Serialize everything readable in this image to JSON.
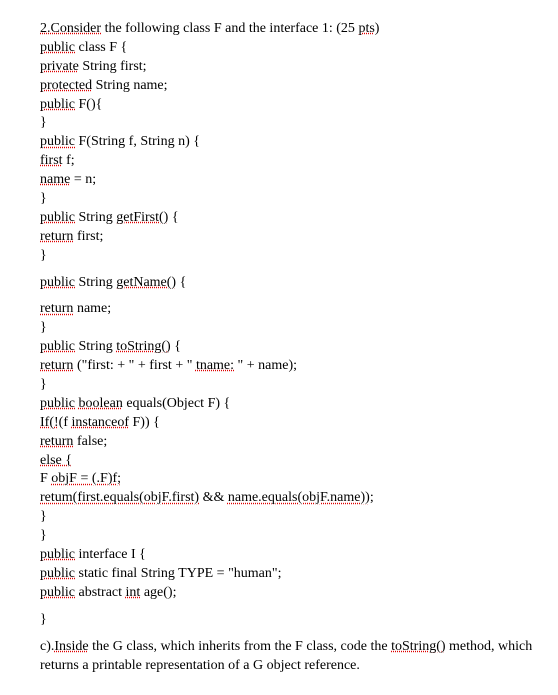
{
  "question": {
    "number": "2.",
    "intro_prefix": "Consider",
    "intro_rest": " the following class F and the interface 1: (25 ",
    "pts": "pts",
    "close_paren": ")"
  },
  "code": {
    "l1_public": "public",
    "l1_rest": " class F {",
    "l2_private": "private",
    "l2_rest": " String first;",
    "l3_protected": "protected",
    "l3_rest": " String name;",
    "l4_public": "public",
    "l4_f": " F(){",
    "l5": "}",
    "l6_public": "public",
    "l6_rest1": " F(String f, String n) {",
    "l7_first": "first",
    "l7_rest": " f;",
    "l8_name": "name",
    "l8_rest": " = n;",
    "l9": "}",
    "l10_public": "public",
    "l10_rest1": " String ",
    "l10_getFirst": "getFirst()",
    "l10_rest2": " {",
    "l11_return": "return",
    "l11_rest": " first;",
    "l12": "}",
    "l13_public": "public",
    "l13_rest1": " String ",
    "l13_getName": "getName()",
    "l13_rest2": " {",
    "l14_return": "return",
    "l14_rest": " name;",
    "l15": "}",
    "l16_public": "public",
    "l16_rest1": " String ",
    "l16_toString": "toString()",
    "l16_rest2": " {",
    "l17_return": "return",
    "l17_rest1": " (\"first: + \" + first + \" ",
    "l17_tname": "tname:",
    "l17_rest2": " \" + name);",
    "l18": "}",
    "l19_public": "public",
    "l19_space": " ",
    "l19_boolean": "boolean",
    "l19_rest": " equals(Object F) {",
    "l20_if": "If(!",
    "l20_rest1": "(f ",
    "l20_instanceof": "instanceof",
    "l20_rest2": " F)) {",
    "l21_return": "return",
    "l21_rest": " false;",
    "l22_else": "else {",
    "l23_fobjf": "F objF = (",
    "l23_fobjf2": ".F)f;",
    "l24_retum": "retum(first.equals(objF.first)",
    "l24_rest1": " && ",
    "l24_rest2": "name.equals(objF.name))",
    "l24_rest3": ";",
    "l25": "}",
    "l26": "}",
    "l27_public": "public",
    "l27_rest": " interface I {",
    "l28_public": "public",
    "l28_rest": " static final String TYPE = \"human\";",
    "l29_public": "public",
    "l29_rest1": " abstract ",
    "l29_int": "int",
    "l29_rest2": " age();",
    "l30": "}"
  },
  "partC": {
    "label_prefix": "c).",
    "label_word": "Inside",
    "text1": " the G class, which inherits from the F class, code the ",
    "toString": "toString()",
    "text2": " method, which returns a printable representation of a G object reference."
  }
}
